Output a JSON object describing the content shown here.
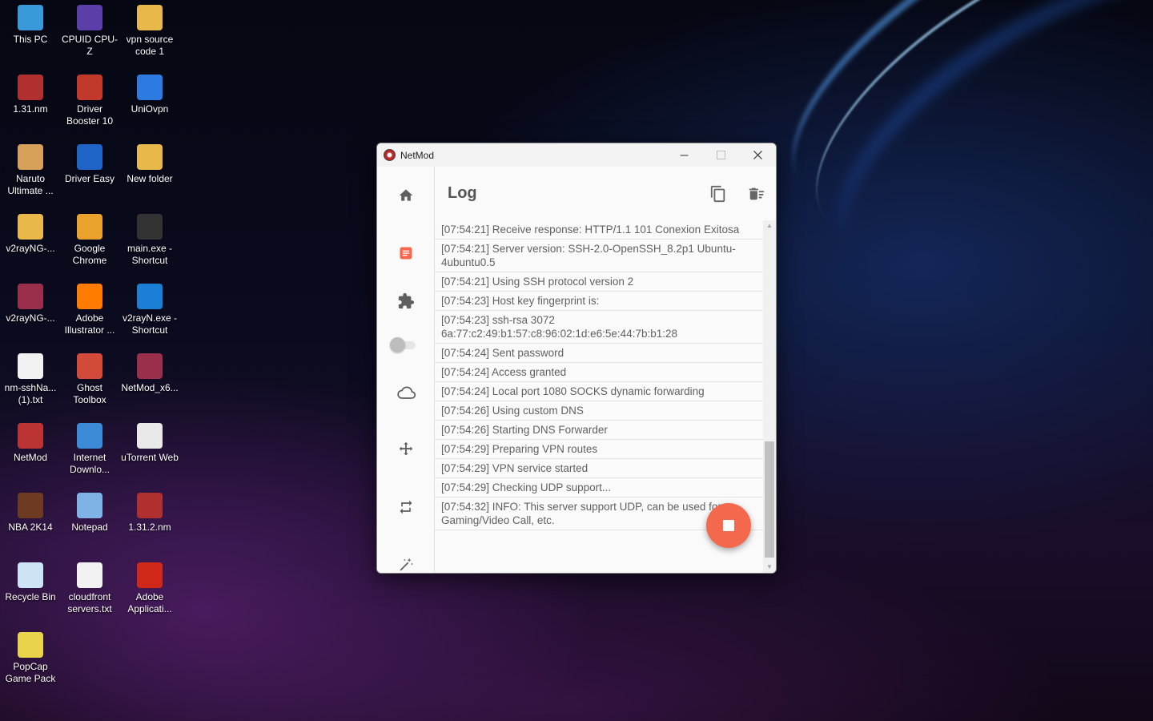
{
  "desktop": {
    "icons": [
      {
        "label": "This PC",
        "icon": "computer-icon"
      },
      {
        "label": "CPUID CPU-Z",
        "icon": "cpu-z-icon"
      },
      {
        "label": "vpn source code 1",
        "icon": "folder-icon"
      },
      {
        "label": "1.31.nm",
        "icon": "netmod-config-icon"
      },
      {
        "label": "Driver Booster 10",
        "icon": "driver-booster-icon"
      },
      {
        "label": "UniOvpn",
        "icon": "uniovpn-icon"
      },
      {
        "label": "Naruto Ultimate ...",
        "icon": "naruto-game-icon"
      },
      {
        "label": "Driver Easy",
        "icon": "driver-easy-icon"
      },
      {
        "label": "New folder",
        "icon": "folder-icon"
      },
      {
        "label": "v2rayNG-...",
        "icon": "folder-icon"
      },
      {
        "label": "Google Chrome",
        "icon": "chrome-icon"
      },
      {
        "label": "main.exe - Shortcut",
        "icon": "exe-shortcut-icon"
      },
      {
        "label": "v2rayNG-...",
        "icon": "archive-icon"
      },
      {
        "label": "Adobe Illustrator ...",
        "icon": "illustrator-icon"
      },
      {
        "label": "v2rayN.exe - Shortcut",
        "icon": "v2rayn-icon"
      },
      {
        "label": "nm-sshNa... (1).txt",
        "icon": "text-file-icon"
      },
      {
        "label": "Ghost Toolbox",
        "icon": "ghost-toolbox-icon"
      },
      {
        "label": "NetMod_x6...",
        "icon": "archive-icon"
      },
      {
        "label": "NetMod",
        "icon": "netmod-icon"
      },
      {
        "label": "Internet Downlo...",
        "icon": "idm-icon"
      },
      {
        "label": "uTorrent Web",
        "icon": "utorrent-icon"
      },
      {
        "label": "NBA 2K14",
        "icon": "nba-game-icon"
      },
      {
        "label": "Notepad",
        "icon": "notepad-icon"
      },
      {
        "label": "1.31.2.nm",
        "icon": "netmod-config-icon"
      },
      {
        "label": "Recycle Bin",
        "icon": "recycle-bin-icon"
      },
      {
        "label": "cloudfront servers.txt",
        "icon": "text-file-icon"
      },
      {
        "label": "Adobe Applicati...",
        "icon": "adobe-icon"
      },
      {
        "label": "PopCap Game Pack",
        "icon": "popcap-icon"
      }
    ]
  },
  "window": {
    "title": "NetMod",
    "controls": {
      "minimize": "—",
      "maximize": "☐",
      "close": "✕"
    },
    "page_title": "Log",
    "sidebar": {
      "items": [
        "home-icon",
        "log-icon",
        "extension-icon",
        "cloud-icon",
        "move-icon",
        "repeat-icon",
        "magic-wand-icon"
      ],
      "toggle_on": false
    },
    "log": [
      "[07:54:21] Receive response: HTTP/1.1 101 Conexion Exitosa",
      "[07:54:21] Server version: SSH-2.0-OpenSSH_8.2p1 Ubuntu-4ubuntu0.5",
      "[07:54:21] Using SSH protocol version 2",
      "[07:54:23] Host key fingerprint is:",
      "[07:54:23] ssh-rsa 3072 6a:77:c2:49:b1:57:c8:96:02:1d:e6:5e:44:7b:b1:28",
      "[07:54:24] Sent password",
      "[07:54:24] Access granted",
      "[07:54:24] Local port 1080 SOCKS dynamic forwarding",
      "[07:54:26] Using custom DNS",
      "[07:54:26] Starting DNS Forwarder",
      "[07:54:29] Preparing VPN routes",
      "[07:54:29] VPN service started",
      "[07:54:29] Checking UDP support...",
      "[07:54:32] INFO: This server support UDP, can be used for Gaming/Video Call, etc."
    ],
    "fab_color": "#f4694d"
  }
}
